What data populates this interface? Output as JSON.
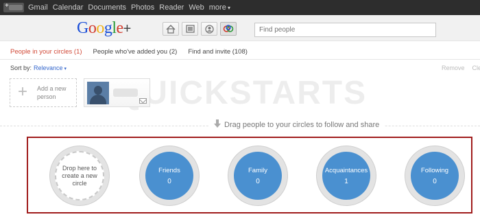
{
  "topbar": {
    "user_initial": "+",
    "nav": [
      "Gmail",
      "Calendar",
      "Documents",
      "Photos",
      "Reader",
      "Web",
      "more"
    ]
  },
  "header": {
    "logo_text": "Google",
    "logo_plus": "+",
    "mode_icons": [
      "home-icon",
      "photos-icon",
      "profile-icon",
      "circles-icon"
    ],
    "search_placeholder": "Find people"
  },
  "tabs": [
    {
      "label": "People in your circles (1)",
      "active": true
    },
    {
      "label": "People who've added you (2)",
      "active": false
    },
    {
      "label": "Find and invite (108)",
      "active": false
    }
  ],
  "sort": {
    "label": "Sort by:",
    "value": "Relevance"
  },
  "actions": [
    "Remove",
    "Cle"
  ],
  "add_person": {
    "label": "Add a new person"
  },
  "watermark": "QUICKSTARTS",
  "drag_hint": "Drag people to your circles to follow and share",
  "drop_circle": {
    "label": "Drop here to create a new circle"
  },
  "circles": [
    {
      "name": "Friends",
      "count": "0"
    },
    {
      "name": "Family",
      "count": "0"
    },
    {
      "name": "Acquaintances",
      "count": "1"
    },
    {
      "name": "Following",
      "count": "0"
    }
  ],
  "colors": {
    "active_tab": "#d14836",
    "circle_fill": "#4a90d0",
    "highlight_border": "#a01c1c"
  }
}
